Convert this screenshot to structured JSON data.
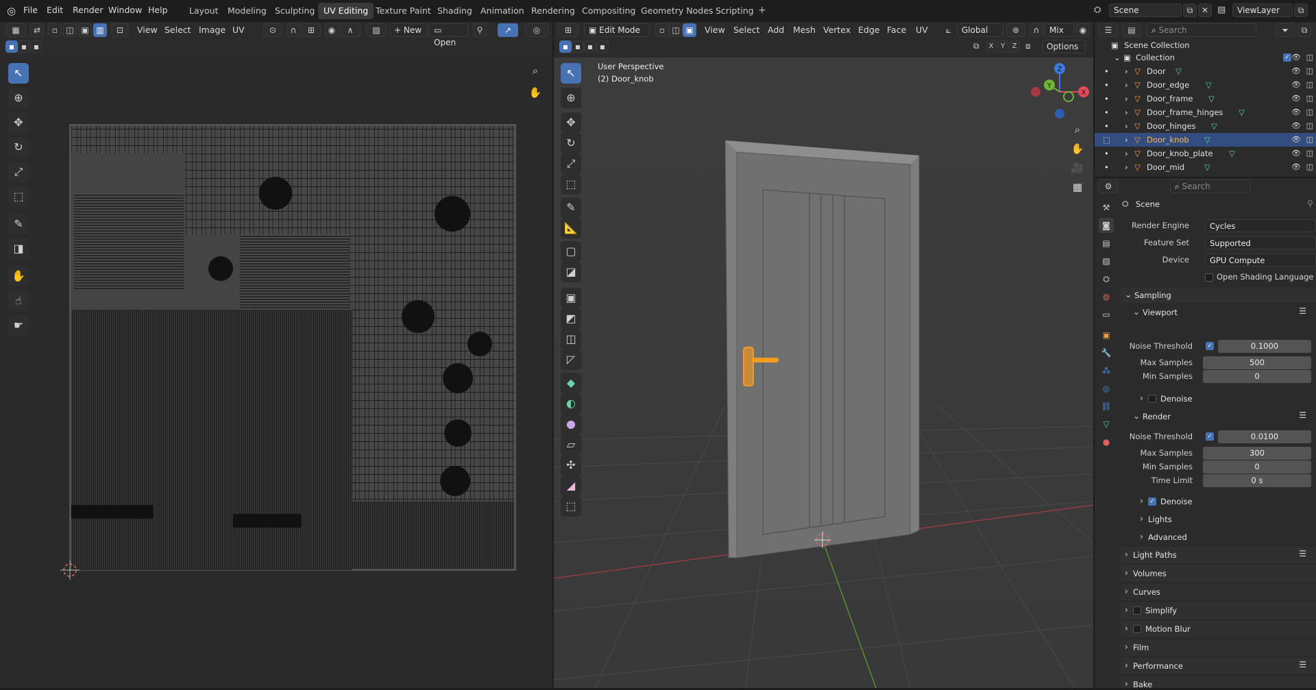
{
  "topbar": {
    "menus": [
      "File",
      "Edit",
      "Render",
      "Window",
      "Help"
    ],
    "workspaces": [
      "Layout",
      "Modeling",
      "Sculpting",
      "UV Editing",
      "Texture Paint",
      "Shading",
      "Animation",
      "Rendering",
      "Compositing",
      "Geometry Nodes",
      "Scripting"
    ],
    "active_workspace": "UV Editing",
    "scene": "Scene",
    "view_layer": "ViewLayer"
  },
  "uv_editor": {
    "menus": [
      "View",
      "Select",
      "Image",
      "UV"
    ],
    "new_label": "New",
    "open_label": "Open"
  },
  "viewport": {
    "mode": "Edit Mode",
    "menus": [
      "View",
      "Select",
      "Add",
      "Mesh",
      "Vertex",
      "Edge",
      "Face",
      "UV"
    ],
    "transform_orientation": "Global",
    "snap_mode": "Mix",
    "options_label": "Options",
    "axes": [
      "X",
      "Y",
      "Z"
    ],
    "overlay_line1": "User Perspective",
    "overlay_line2": "(2) Door_knob",
    "gizmo": {
      "x": "X",
      "y": "Y",
      "z": "Z"
    }
  },
  "outliner": {
    "search_placeholder": "Search",
    "scene_collection": "Scene Collection",
    "collection": "Collection",
    "objects": [
      "Door",
      "Door_edge",
      "Door_frame",
      "Door_frame_hinges",
      "Door_hinges",
      "Door_knob",
      "Door_knob_plate",
      "Door_mid"
    ],
    "selected": "Door_knob"
  },
  "properties": {
    "search_placeholder": "Search",
    "context": "Scene",
    "render_engine_label": "Render Engine",
    "render_engine": "Cycles",
    "feature_set_label": "Feature Set",
    "feature_set": "Supported",
    "device_label": "Device",
    "device": "GPU Compute",
    "osl_label": "Open Shading Language",
    "sampling": "Sampling",
    "viewport": "Viewport",
    "noise_threshold_label": "Noise Threshold",
    "viewport_noise_threshold": "0.1000",
    "max_samples_label": "Max Samples",
    "viewport_max_samples": "500",
    "min_samples_label": "Min Samples",
    "viewport_min_samples": "0",
    "denoise_label": "Denoise",
    "render": "Render",
    "render_noise_threshold": "0.0100",
    "render_max_samples": "300",
    "render_min_samples": "0",
    "time_limit_label": "Time Limit",
    "time_limit": "0 s",
    "lights": "Lights",
    "advanced": "Advanced",
    "panels": [
      "Light Paths",
      "Volumes",
      "Curves",
      "Simplify",
      "Motion Blur",
      "Film",
      "Performance",
      "Bake"
    ]
  },
  "colors": {
    "accent": "#4772b3",
    "selection_orange": "#f39c1f",
    "axis_x": "#e34b5b",
    "axis_y": "#6fb536",
    "axis_z": "#3b7be0"
  }
}
